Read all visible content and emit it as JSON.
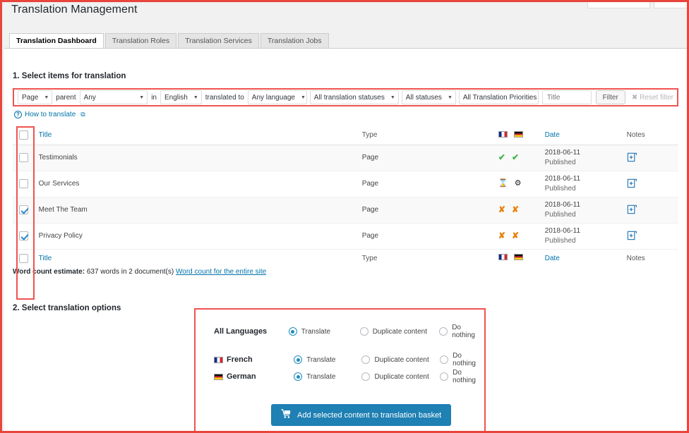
{
  "page": {
    "title": "Translation Management"
  },
  "tabs": [
    {
      "label": "Translation Dashboard",
      "active": true
    },
    {
      "label": "Translation Roles",
      "active": false
    },
    {
      "label": "Translation Services",
      "active": false
    },
    {
      "label": "Translation Jobs",
      "active": false
    }
  ],
  "section1": {
    "heading": "1. Select items for translation"
  },
  "section2": {
    "heading": "2. Select translation options"
  },
  "filter": {
    "post_type": "Page",
    "parent_label": "parent",
    "parent": "Any",
    "in_label": "in",
    "language": "English",
    "translated_to_label": "translated to",
    "target_language": "Any language",
    "translation_status": "All translation statuses",
    "status": "All statuses",
    "priority": "All Translation Priorities",
    "title_placeholder": "Title",
    "title_value": "",
    "filter_button": "Filter",
    "reset_button": "Reset filter"
  },
  "howto": {
    "label": "How to translate"
  },
  "table": {
    "columns": {
      "title": "Title",
      "type": "Type",
      "date": "Date",
      "notes": "Notes"
    },
    "flags": [
      {
        "name": "french-flag",
        "code": "fr"
      },
      {
        "name": "german-flag",
        "code": "de"
      }
    ],
    "rows": [
      {
        "title": "Testimonials",
        "type": "Page",
        "checked": false,
        "statuses": [
          "translated",
          "translated"
        ],
        "date": "2018-06-11",
        "status_text": "Published",
        "note_icon": "add-note-icon"
      },
      {
        "title": "Our Services",
        "type": "Page",
        "checked": false,
        "statuses": [
          "in-progress",
          "in-progress-gear"
        ],
        "date": "2018-06-11",
        "status_text": "Published",
        "note_icon": "add-note-icon"
      },
      {
        "title": "Meet The Team",
        "type": "Page",
        "checked": true,
        "statuses": [
          "not-translated",
          "not-translated"
        ],
        "date": "2018-06-11",
        "status_text": "Published",
        "note_icon": "add-note-icon"
      },
      {
        "title": "Privacy Policy",
        "type": "Page",
        "checked": true,
        "statuses": [
          "not-translated",
          "not-translated"
        ],
        "date": "2018-06-11",
        "status_text": "Published",
        "note_icon": "add-note-icon"
      }
    ]
  },
  "wordcount": {
    "label": "Word count estimate:",
    "value": "637 words in 2 document(s)",
    "link": "Word count for the entire site"
  },
  "options": {
    "all_languages_label": "All Languages",
    "choices": [
      "Translate",
      "Duplicate content",
      "Do nothing"
    ],
    "all_selected": "Translate",
    "languages": [
      {
        "name": "French",
        "flag": "fr",
        "selected": "Translate"
      },
      {
        "name": "German",
        "flag": "de",
        "selected": "Translate"
      }
    ]
  },
  "basket": {
    "label": "Add selected content to translation basket",
    "icon": "cart-icon"
  },
  "colors": {
    "accent_red": "#ef5350",
    "link_blue": "#0073aa",
    "button_blue": "#1e80b3",
    "green": "#46b450",
    "orange": "#e8820c"
  }
}
